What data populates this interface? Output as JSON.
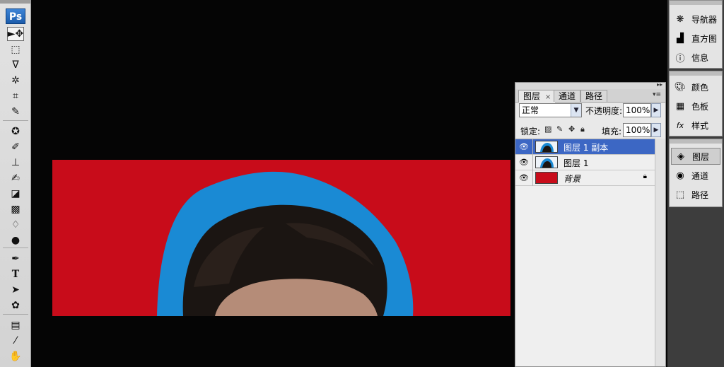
{
  "app": {
    "logo": "Ps"
  },
  "tools": [
    {
      "name": "move-tool",
      "icon": "►✥",
      "selected": true
    },
    {
      "name": "marquee-tool",
      "icon": "⬚"
    },
    {
      "name": "lasso-tool",
      "icon": "ᐁ"
    },
    {
      "name": "magic-wand-tool",
      "icon": "✲"
    },
    {
      "name": "crop-tool",
      "icon": "⌗"
    },
    {
      "name": "eyedropper-tool",
      "icon": "✎"
    },
    {
      "name": "healing-brush-tool",
      "icon": "✪"
    },
    {
      "name": "brush-tool",
      "icon": "✐"
    },
    {
      "name": "clone-stamp-tool",
      "icon": "⊥"
    },
    {
      "name": "history-brush-tool",
      "icon": "✍"
    },
    {
      "name": "eraser-tool",
      "icon": "◪"
    },
    {
      "name": "gradient-tool",
      "icon": "▩"
    },
    {
      "name": "blur-tool",
      "icon": "♢"
    },
    {
      "name": "dodge-tool",
      "icon": "●"
    },
    {
      "name": "pen-tool",
      "icon": "✒"
    },
    {
      "name": "type-tool",
      "icon": "T"
    },
    {
      "name": "path-selection-tool",
      "icon": "➤"
    },
    {
      "name": "custom-shape-tool",
      "icon": "✿"
    },
    {
      "name": "notes-tool",
      "icon": "▤"
    },
    {
      "name": "eyedropper-sample-tool",
      "icon": "⁄"
    },
    {
      "name": "hand-tool",
      "icon": "✋"
    }
  ],
  "layers_panel": {
    "tabs": [
      {
        "label": "图层",
        "close": "×"
      },
      {
        "label": "通道"
      },
      {
        "label": "路径"
      }
    ],
    "blend_mode": "正常",
    "opacity_label": "不透明度:",
    "opacity_value": "100%",
    "lock_label": "锁定:",
    "fill_label": "填充:",
    "fill_value": "100%",
    "layers": [
      {
        "name": "图层 1 副本",
        "selected": true,
        "visible": true
      },
      {
        "name": "图层 1",
        "selected": false,
        "visible": true
      },
      {
        "name": "背景",
        "selected": false,
        "visible": true,
        "locked": true
      }
    ]
  },
  "dock": {
    "group1": [
      {
        "label": "导航器",
        "icon": "navigator-icon"
      },
      {
        "label": "直方图",
        "icon": "histogram-icon"
      },
      {
        "label": "信息",
        "icon": "info-icon"
      }
    ],
    "group2": [
      {
        "label": "颜色",
        "icon": "color-icon"
      },
      {
        "label": "色板",
        "icon": "swatches-icon"
      },
      {
        "label": "样式",
        "icon": "styles-icon"
      }
    ],
    "group3": [
      {
        "label": "图层",
        "icon": "layers-icon",
        "active": true
      },
      {
        "label": "通道",
        "icon": "channels-icon"
      },
      {
        "label": "路径",
        "icon": "paths-icon"
      }
    ]
  },
  "colors": {
    "canvas_background": "#c80c1a",
    "photo_backdrop": "#1a8ad4",
    "selection": "#3c67c4"
  }
}
